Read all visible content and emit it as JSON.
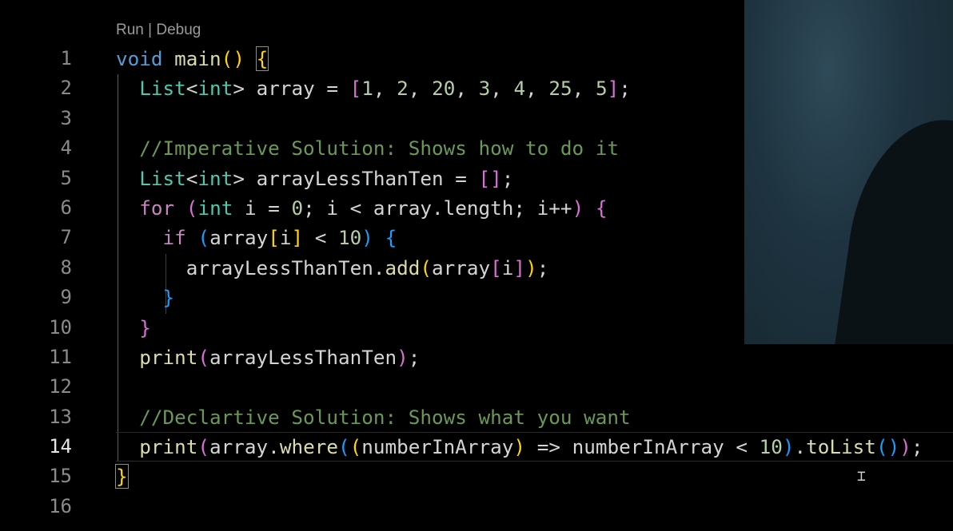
{
  "codelens": "Run | Debug",
  "line_numbers": [
    "1",
    "2",
    "3",
    "4",
    "5",
    "6",
    "7",
    "8",
    "9",
    "10",
    "11",
    "12",
    "13",
    "14",
    "15",
    "16"
  ],
  "active_line": "14",
  "code": {
    "l1": {
      "void": "void",
      "main": "main",
      "paren_open": "(",
      "paren_close": ")",
      "brace": "{"
    },
    "l2": {
      "type1": "List",
      "lt": "<",
      "type2": "int",
      "gt": ">",
      "rest": " array = ",
      "br_open": "[",
      "n1": "1",
      "n2": "2",
      "n3": "20",
      "n4": "3",
      "n5": "4",
      "n6": "25",
      "n7": "5",
      "br_close": "]",
      "semi": ";"
    },
    "l4": {
      "comment": "//Imperative Solution: Shows how to do it"
    },
    "l5": {
      "type1": "List",
      "lt": "<",
      "type2": "int",
      "gt": ">",
      "rest": " arrayLessThanTen = ",
      "brackets": "[]",
      "semi": ";"
    },
    "l6": {
      "for": "for",
      "p_open": "(",
      "int": "int",
      "a": " i = ",
      "zero": "0",
      "b": "; i < array.length; i++",
      "p_close": ")",
      "brace": "{"
    },
    "l7": {
      "if": "if",
      "p_open": "(",
      "a": "array",
      "sq_open": "[",
      "i": "i",
      "sq_close": "]",
      "b": " < ",
      "ten": "10",
      "p_close": ")",
      "brace": "{"
    },
    "l8": {
      "obj": "arrayLessThanTen.",
      "add": "add",
      "p_open": "(",
      "a": "array",
      "sq_open": "[",
      "i": "i",
      "sq_close": "]",
      "p_close": ")",
      "semi": ";"
    },
    "l9": {
      "brace": "}"
    },
    "l10": {
      "brace": "}"
    },
    "l11": {
      "print": "print",
      "p_open": "(",
      "arg": "arrayLessThanTen",
      "p_close": ")",
      "semi": ";"
    },
    "l13": {
      "comment": "//Declartive Solution: Shows what you want"
    },
    "l14": {
      "print": "print",
      "p1": "(",
      "a": "array.",
      "where": "where",
      "p2": "(",
      "p3": "(",
      "param": "numberInArray",
      "p3c": ")",
      "arrow": " => numberInArray < ",
      "ten": "10",
      "p2c": ")",
      "dot": ".",
      "toList": "toList",
      "p4": "()",
      "p1c": ")",
      "semi": ";"
    },
    "l15": {
      "brace": "}"
    }
  },
  "icons": {
    "text_cursor": "i-beam-cursor-icon"
  }
}
